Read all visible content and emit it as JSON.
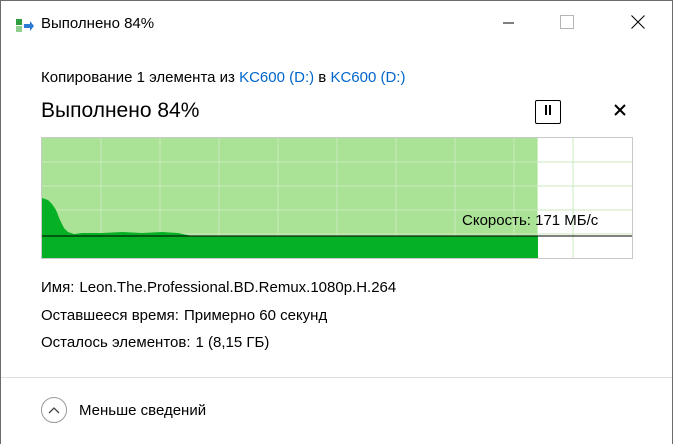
{
  "window": {
    "title": "Выполнено 84%"
  },
  "header": {
    "copy_prefix": "Копирование 1 элемента из",
    "source": "KC600 (D:)",
    "copy_middle": "в",
    "destination": "KC600 (D:)",
    "progress_title": "Выполнено 84%",
    "progress_percent": 84
  },
  "graph": {
    "speed_label": "Скорость: 171 МБ/с",
    "colors": {
      "fill_done": "#abe396",
      "fill_speed": "#06b025",
      "grid": "#c9e9bd",
      "line": "#000000"
    }
  },
  "details": {
    "name_label": "Имя:",
    "name_value": "Leon.The.Professional.BD.Remux.1080p.H.264",
    "time_label": "Оставшееся время:",
    "time_value": "Примерно 60 секунд",
    "items_label": "Осталось элементов:",
    "items_value": "1 (8,15 ГБ)"
  },
  "footer": {
    "toggle_label": "Меньше сведений",
    "icon": "chevron-up-icon"
  },
  "icons": {
    "app": "copy-file-icon",
    "minimize": "minimize-icon",
    "maximize": "maximize-icon",
    "close": "close-icon",
    "pause": "pause-icon",
    "cancel": "cancel-icon"
  }
}
